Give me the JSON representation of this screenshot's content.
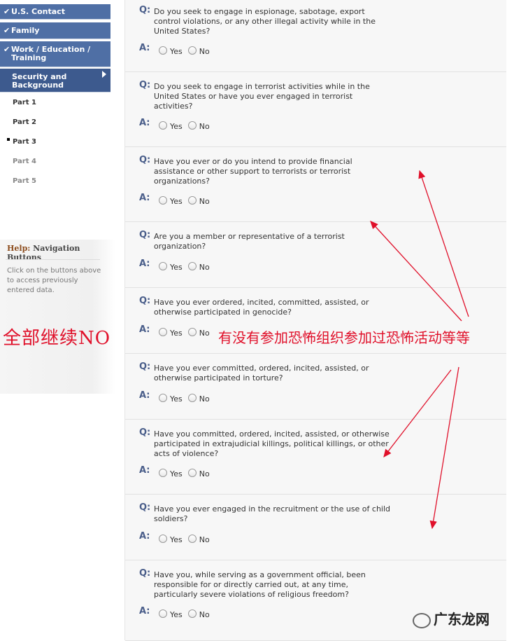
{
  "sidebar": {
    "nav": [
      {
        "label": "U.S. Contact",
        "checked": true
      },
      {
        "label": "Family",
        "checked": true
      },
      {
        "label": "Work / Education /",
        "label2": "Training",
        "checked": true
      },
      {
        "label": "Security and",
        "label2": "Background",
        "checked": false,
        "active": true
      }
    ],
    "parts": [
      "Part 1",
      "Part 2",
      "Part 3",
      "Part 4",
      "Part 5"
    ],
    "current_part": "Part 3"
  },
  "help": {
    "label": "Help:",
    "title": "Navigation Buttons",
    "text": "Click on the buttons above to access previously entered data."
  },
  "form": {
    "q_prefix": "Q:",
    "a_prefix": "A:",
    "yes_label": "Yes",
    "no_label": "No",
    "questions": [
      {
        "text": "Do you seek to engage in espionage, sabotage, export control violations, or any other illegal activity while in the United States?"
      },
      {
        "text": "Do you seek to engage in terrorist activities while in the United States or have you ever engaged in terrorist activities?"
      },
      {
        "text": "Have you ever or do you intend to provide financial assistance or other support to terrorists or terrorist organizations?"
      },
      {
        "text": "Are you a member or representative of a terrorist organization?"
      },
      {
        "text": "Have you ever ordered, incited, committed, assisted, or otherwise participated in genocide?"
      },
      {
        "text": "Have you ever committed, ordered, incited, assisted, or otherwise participated in torture?"
      },
      {
        "text": "Have you committed, ordered, incited, assisted, or otherwise participated in extrajudicial killings, political killings, or other acts of violence?"
      },
      {
        "text": "Have you ever engaged in the recruitment or the use of child soldiers?"
      },
      {
        "text": "Have you, while serving as a government official, been responsible for or directly carried out, at any time, particularly severe violations of religious freedom?"
      }
    ]
  },
  "annotations": {
    "left": "全部继续NO",
    "right": "有没有参加恐怖组织参加过恐怖活动等等",
    "color": "#e0102a"
  },
  "watermark": "广东龙网"
}
